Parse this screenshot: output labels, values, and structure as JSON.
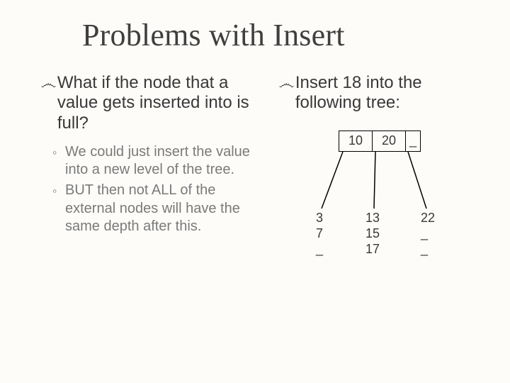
{
  "title": "Problems with Insert",
  "left": {
    "q": "What if the node that a value gets inserted into is full?",
    "sub1": "We could just insert the value into a new level of the tree.",
    "sub2": "BUT then not ALL of the external nodes will have the same depth after this."
  },
  "right": {
    "prompt": "Insert 18 into the following tree:"
  },
  "tree": {
    "root": {
      "a": "10",
      "b": "20",
      "c": "_"
    },
    "leaf1": {
      "l1": "3",
      "l2": "7",
      "l3": "_"
    },
    "leaf2": {
      "l1": "13",
      "l2": "15",
      "l3": "17"
    },
    "leaf3": {
      "l1": "22",
      "l2": "_",
      "l3": "_"
    }
  },
  "marks": {
    "spiral": "෴",
    "ring": "◦"
  }
}
